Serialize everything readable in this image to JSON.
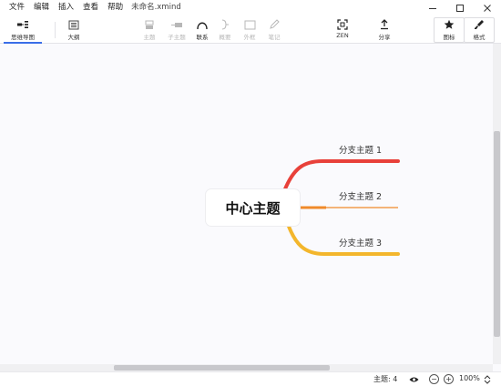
{
  "menubar": {
    "items": [
      "文件",
      "编辑",
      "插入",
      "查看",
      "帮助"
    ],
    "document_title": "未命名.xmind"
  },
  "toolbar": {
    "mindmap_label": "思维导图",
    "outline_label": "大纲",
    "topic_label": "主题",
    "subtopic_label": "子主题",
    "relationship_label": "联系",
    "summary_label": "概要",
    "boundary_label": "外框",
    "note_label": "笔记",
    "zen_label": "ZEN",
    "share_label": "分享",
    "icon_label": "图标",
    "format_label": "格式"
  },
  "map": {
    "central_topic": "中心主题",
    "branches": [
      {
        "label": "分支主题 1",
        "color": "#e8413a"
      },
      {
        "label": "分支主题 2",
        "color": "#f08a2a"
      },
      {
        "label": "分支主题 3",
        "color": "#f3b62c"
      }
    ]
  },
  "status": {
    "topics_count": "主题: 4",
    "zoom": "100%"
  },
  "icons": {
    "window": [
      "minimize-icon",
      "maximize-icon",
      "close-icon"
    ],
    "status": [
      "eye-icon",
      "zoom-out-icon",
      "zoom-in-icon",
      "chevron-updown-icon"
    ]
  }
}
